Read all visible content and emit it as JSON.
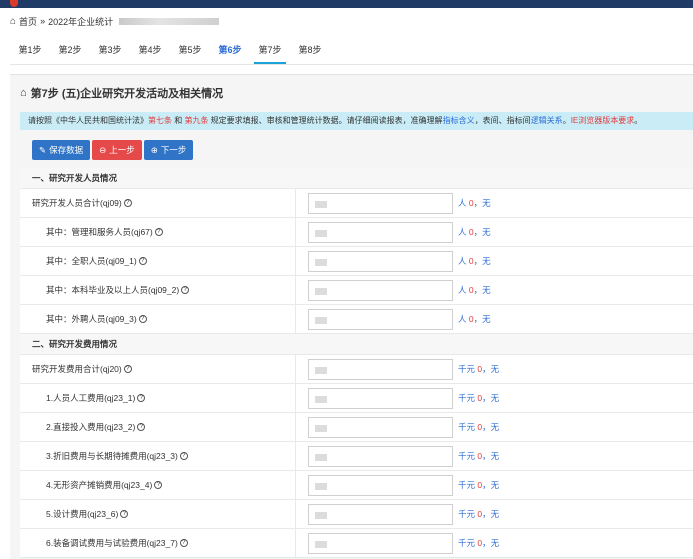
{
  "breadcrumb": {
    "home": "首页",
    "sep": "»",
    "current": "2022年企业统计"
  },
  "steps": [
    "第1步",
    "第2步",
    "第3步",
    "第4步",
    "第5步",
    "第6步",
    "第7步",
    "第8步"
  ],
  "panel": {
    "title": "第7步 (五)企业研究开发活动及相关情况"
  },
  "notice": {
    "p1": "请按照《中华人民共和国统计法》",
    "r1": "第七条",
    "p2": " 和 ",
    "r2": "第九条",
    "p3": " 规定要求填报、审核和管理统计数据。请仔细阅读报表，准确理解",
    "b1": "指标含义",
    "p4": "，表间、指标间",
    "b2": "逻辑关系",
    "p5": "。",
    "r3": "IE浏览器版本要求",
    "p6": "。"
  },
  "buttons": {
    "save": "保存数据",
    "prev": "上一步",
    "next": "下一步"
  },
  "sections": [
    {
      "title": "一、研究开发人员情况",
      "rows": [
        {
          "label": "研究开发人员合计(qj09)",
          "unit": "人",
          "zero": "0",
          "none": "无"
        },
        {
          "label": "其中：管理和服务人员(qj67)",
          "unit": "人",
          "zero": "0",
          "none": "无"
        },
        {
          "label": "其中：全职人员(qj09_1)",
          "unit": "人",
          "zero": "0",
          "none": "无"
        },
        {
          "label": "其中：本科毕业及以上人员(qj09_2)",
          "unit": "人",
          "zero": "0",
          "none": "无"
        },
        {
          "label": "其中：外聘人员(qj09_3)",
          "unit": "人",
          "zero": "0",
          "none": "无"
        }
      ]
    },
    {
      "title": "二、研究开发费用情况",
      "rows": [
        {
          "label": "研究开发费用合计(qj20)",
          "unit": "千元",
          "zero": "0",
          "none": "无"
        },
        {
          "label": "1.人员人工费用(qj23_1)",
          "unit": "千元",
          "zero": "0",
          "none": "无"
        },
        {
          "label": "2.直接投入费用(qj23_2)",
          "unit": "千元",
          "zero": "0",
          "none": "无"
        },
        {
          "label": "3.折旧费用与长期待摊费用(qj23_3)",
          "unit": "千元",
          "zero": "0",
          "none": "无"
        },
        {
          "label": "4.无形资产摊销费用(qj23_4)",
          "unit": "千元",
          "zero": "0",
          "none": "无"
        },
        {
          "label": "5.设计费用(qj23_6)",
          "unit": "千元",
          "zero": "0",
          "none": "无"
        },
        {
          "label": "6.装备调试费用与试验费用(qj23_7)",
          "unit": "千元",
          "zero": "0",
          "none": "无"
        }
      ]
    }
  ]
}
